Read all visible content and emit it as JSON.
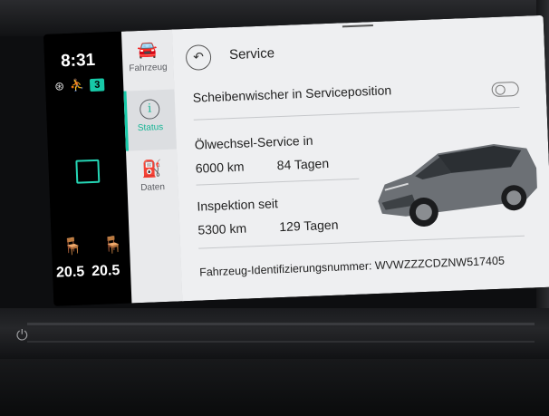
{
  "status": {
    "time": "8:31",
    "badge_count": "3",
    "temp_left": "20.5",
    "temp_right": "20.5"
  },
  "tabs": [
    {
      "label": "Fahrzeug",
      "icon": "car-icon"
    },
    {
      "label": "Status",
      "icon": "info-icon",
      "active": true
    },
    {
      "label": "Daten",
      "icon": "fuel-data-icon"
    }
  ],
  "header": {
    "title": "Service"
  },
  "wiper": {
    "label": "Scheibenwischer in Serviceposition",
    "enabled": false
  },
  "oil_service": {
    "label": "Ölwechsel-Service in",
    "distance": "6000 km",
    "days": "84 Tagen"
  },
  "inspection": {
    "label": "Inspektion seit",
    "distance": "5300 km",
    "days": "129 Tagen"
  },
  "vin": {
    "text": "Fahrzeug-Identifizierungsnummer: WVWZZZCDZNW517405"
  },
  "colors": {
    "accent": "#17c9a8",
    "panel": "#eeeff1"
  }
}
